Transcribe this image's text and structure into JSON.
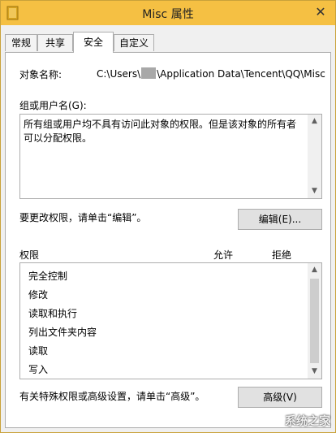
{
  "window": {
    "title": "Misc 属性",
    "close_glyph": "✕",
    "title_color": "#f5c043"
  },
  "tabs": [
    {
      "label": "常规"
    },
    {
      "label": "共享"
    },
    {
      "label": "安全",
      "active": true
    },
    {
      "label": "自定义"
    }
  ],
  "security": {
    "object_name_label": "对象名称:",
    "object_path_prefix": "C:\\Users\\",
    "object_path_suffix": "\\Application Data\\Tencent\\QQ\\Misc",
    "group_label": "组或用户名(G):",
    "group_message": "所有组或用户均不具有访问此对象的权限。但是该对象的所有者可以分配权限。",
    "change_hint": "要更改权限，请单击“编辑”。",
    "edit_button": "编辑(E)...",
    "permissions_header": "权限",
    "allow_header": "允许",
    "deny_header": "拒绝",
    "permissions": [
      "完全控制",
      "修改",
      "读取和执行",
      "列出文件夹内容",
      "读取",
      "写入"
    ],
    "advanced_hint": "有关特殊权限或高级设置，请单击“高级”。",
    "advanced_button": "高级(V)"
  },
  "watermark": "系统之家",
  "icons": {
    "folder": "folder-icon",
    "close": "close-icon",
    "scroll_up": "scroll-up-icon",
    "scroll_down": "scroll-down-icon"
  }
}
